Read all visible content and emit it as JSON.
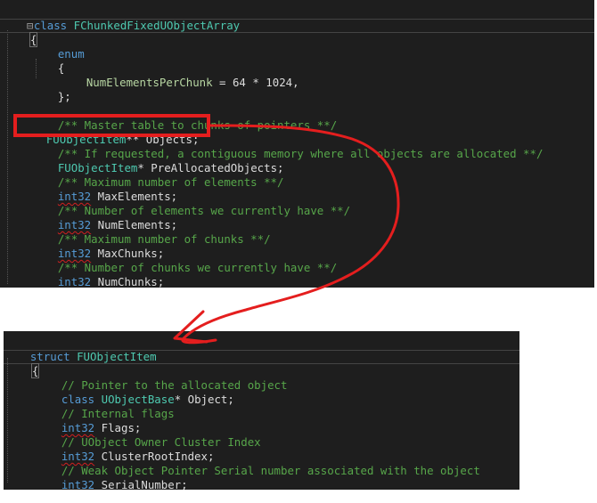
{
  "top_code": {
    "header_kw": "class",
    "header_name": "FChunkedFixedUObjectArray",
    "open_brace": "{",
    "enum_kw": "enum",
    "enum_open": "{",
    "enum_member": "NumElementsPerChunk",
    "enum_rest": " = 64 * 1024,",
    "enum_close": "};",
    "comment_master": "/** Master table to chunks of pointers **/",
    "objects_type": "FUObjectItem",
    "objects_rest": "** Objects;",
    "comment_prealloc": "/** If requested, a contiguous memory where all objects are allocated **/",
    "prealloc_type": "FUObjectItem",
    "prealloc_rest": "* PreAllocatedObjects;",
    "comment_max_el": "/** Maximum number of elements **/",
    "max_el_type": "int32",
    "max_el_rest": " MaxElements;",
    "comment_num_el": "/** Number of elements we currently have **/",
    "num_el_type": "int32",
    "num_el_rest": " NumElements;",
    "comment_max_ch": "/** Maximum number of chunks **/",
    "max_ch_type": "int32",
    "max_ch_rest": " MaxChunks;",
    "comment_num_ch": "/** Number of chunks we currently have **/",
    "num_ch_type": "int32",
    "num_ch_rest": " NumChunks;"
  },
  "bottom_code": {
    "header_kw": "struct",
    "header_name": "FUObjectItem",
    "open_brace": "{",
    "comment_object": "// Pointer to the allocated object",
    "object_kw": "class",
    "object_type": "UObjectBase",
    "object_rest": "* Object;",
    "comment_flags": "// Internal flags",
    "flags_type": "int32",
    "flags_rest": " Flags;",
    "comment_cluster": "// UObject Owner Cluster Index",
    "cluster_type": "int32",
    "cluster_rest": " ClusterRootIndex;",
    "comment_serial": "// Weak Object Pointer Serial number associated with the object",
    "serial_type": "int32",
    "serial_rest": " SerialNumber;"
  },
  "colors": {
    "editor_bg": "#1e1e1e",
    "keyword": "#569cd6",
    "type": "#4ec9b0",
    "comment": "#57a64a",
    "annotation": "#e41e1e"
  }
}
